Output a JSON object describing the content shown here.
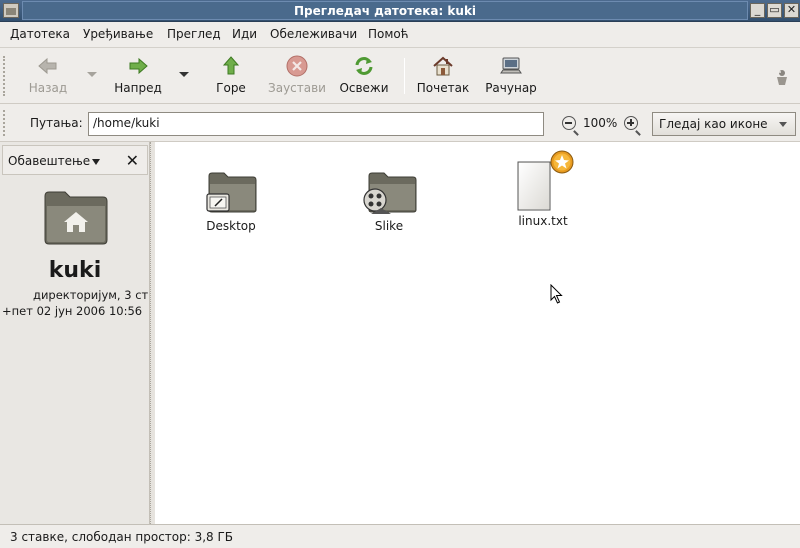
{
  "window": {
    "title": "Прегледач датотека: kuki"
  },
  "menu": {
    "items": [
      "Датотека",
      "Уређивање",
      "Преглед",
      "Иди",
      "Обележивачи",
      "Помоћ"
    ]
  },
  "toolbar": {
    "back": "Назад",
    "forward": "Напред",
    "up": "Горе",
    "stop": "Заустави",
    "reload": "Освежи",
    "home": "Почетак",
    "computer": "Рачунар"
  },
  "location": {
    "label": "Путања:",
    "path": "/home/kuki",
    "zoom": "100%",
    "view_mode": "Гледај као иконе"
  },
  "sidebar": {
    "selector": "Обавештење",
    "folder_name": "kuki",
    "info_line1": "директоријум, 3 ст",
    "info_line2": "+пет 02 јун 2006 10:56"
  },
  "files": [
    {
      "name": "Desktop",
      "icon": "desktop-folder-icon"
    },
    {
      "name": "Slike",
      "icon": "pictures-folder-icon"
    },
    {
      "name": "linux.txt",
      "icon": "text-file-icon"
    }
  ],
  "status": {
    "text": "3 ставке, слободан простор: 3,8 ГБ"
  },
  "colors": {
    "titlebar": "#3d5c80",
    "view_bg": "#ffffff",
    "chrome_bg": "#efedea"
  }
}
